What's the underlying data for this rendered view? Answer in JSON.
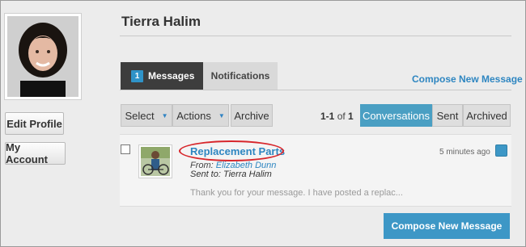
{
  "profile": {
    "name": "Tierra Halim",
    "edit_profile_label": "Edit Profile",
    "my_account_label": "My Account"
  },
  "tabs": {
    "messages_label": "Messages",
    "messages_count": "1",
    "notifications_label": "Notifications"
  },
  "compose_link_label": "Compose New Message",
  "toolbar": {
    "select_label": "Select",
    "actions_label": "Actions",
    "archive_label": "Archive",
    "pager_range": "1-1",
    "pager_of": "of",
    "pager_total": "1"
  },
  "views": {
    "conversations": "Conversations",
    "sent": "Sent",
    "archived": "Archived"
  },
  "message": {
    "subject": "Replacement Parts",
    "from_label": "From:",
    "from_name": "Elizabeth Dunn",
    "sent_to": "Sent to: Tierra Halim",
    "preview": "Thank you for your message. I have posted a replac...",
    "time": "5 minutes ago"
  },
  "compose_button_label": "Compose New Message",
  "colors": {
    "accent": "#3d97c6",
    "link": "#2e86c1",
    "dark_tab": "#3d3d3d",
    "annotation": "#d7262b"
  }
}
